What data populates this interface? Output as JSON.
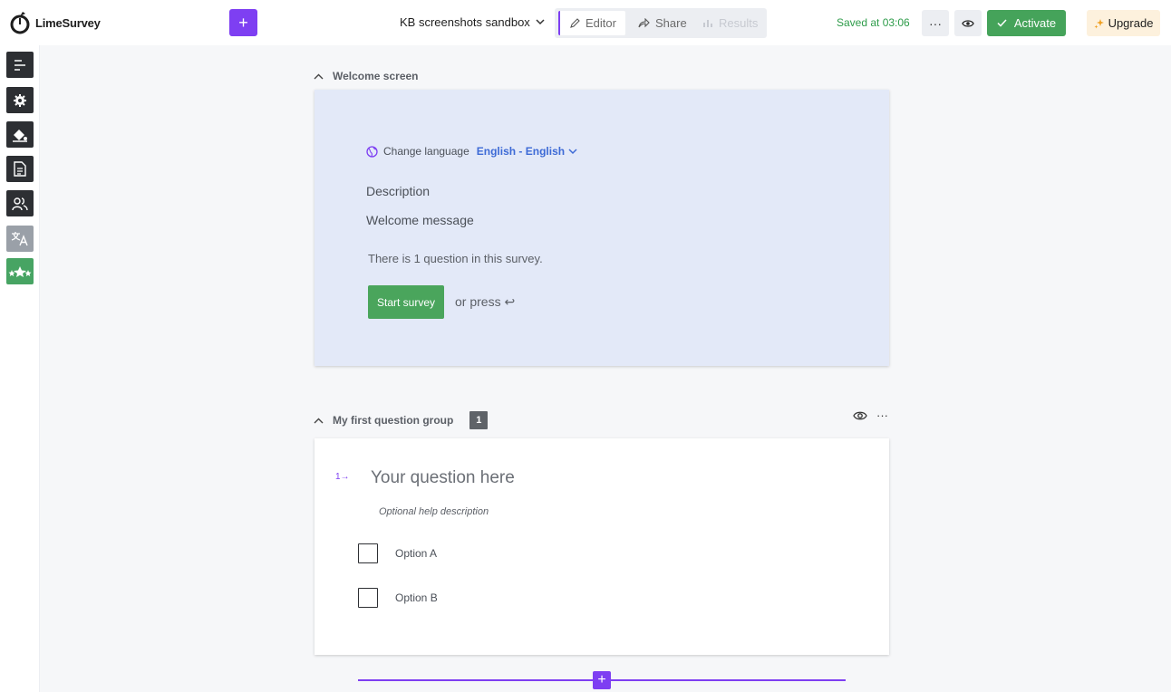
{
  "app": {
    "name": "LimeSurvey"
  },
  "header": {
    "survey_title": "KB screenshots sandbox",
    "tabs": [
      {
        "label": "Editor",
        "icon": "pencil-icon",
        "active": true
      },
      {
        "label": "Share",
        "icon": "share-icon",
        "active": false
      },
      {
        "label": "Results",
        "icon": "bar-chart-icon",
        "active": false
      }
    ],
    "saved_status": "Saved at 03:06",
    "more_label": "···",
    "activate_label": "Activate",
    "upgrade_label": "Upgrade"
  },
  "sidebar": {
    "items": [
      {
        "icon": "structure-icon"
      },
      {
        "icon": "settings-icon"
      },
      {
        "icon": "theme-bucket-icon"
      },
      {
        "icon": "document-icon"
      },
      {
        "icon": "participants-icon"
      },
      {
        "icon": "translate-icon"
      },
      {
        "icon": "stars-icon"
      }
    ]
  },
  "welcome": {
    "section_title": "Welcome screen",
    "change_language_label": "Change language",
    "language_value": "English - English",
    "description": "Description",
    "welcome_message": "Welcome message",
    "question_count_text": "There is 1 question in this survey.",
    "start_button": "Start survey",
    "press_hint": "or press ↩"
  },
  "group": {
    "title": "My first question group",
    "badge": "1",
    "more_label": "···",
    "question": {
      "number": "1→",
      "title": "Your question here",
      "help": "Optional help description",
      "options": [
        "Option A",
        "Option B"
      ]
    }
  },
  "colors": {
    "brand_purple": "#7e3ff2",
    "green": "#45a35a",
    "welcome_bg": "#e3e9f8",
    "link_blue": "#3d6ad6"
  }
}
